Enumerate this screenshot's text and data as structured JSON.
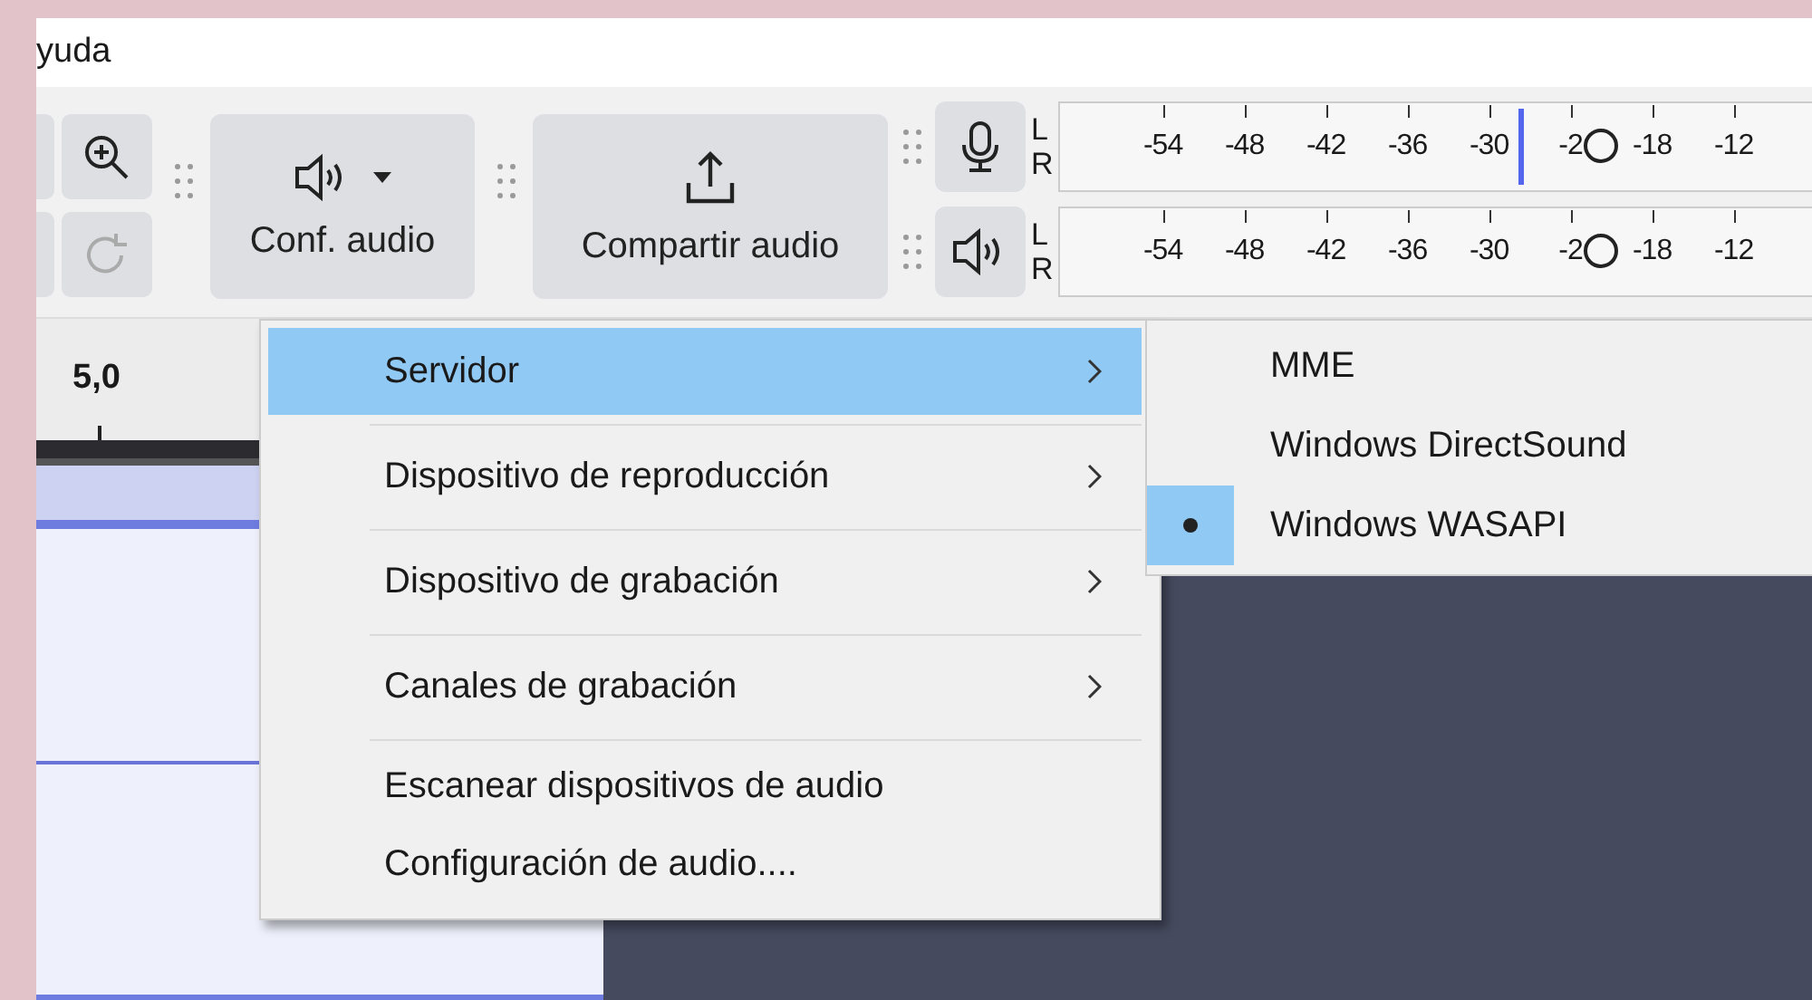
{
  "menu_bar": {
    "items": [
      "yuda"
    ]
  },
  "toolbar": {
    "buttons": [
      {
        "kind": "stub"
      },
      {
        "kind": "zoom"
      },
      {
        "kind": "stub"
      },
      {
        "kind": "redo",
        "disabled": true
      }
    ],
    "audio_setup": {
      "label": "Conf. audio"
    },
    "share_audio": {
      "label": "Compartir audio"
    }
  },
  "meters": [
    {
      "kind": "record",
      "channels": [
        "L",
        "R"
      ],
      "ticks": [
        "-54",
        "-48",
        "-42",
        "-36",
        "-30",
        "-2",
        "-18",
        "-12"
      ],
      "level": 0.72,
      "marker": true
    },
    {
      "kind": "playback",
      "channels": [
        "L",
        "R"
      ],
      "ticks": [
        "-54",
        "-48",
        "-42",
        "-36",
        "-30",
        "-2",
        "-18",
        "-12"
      ],
      "level": 0.72,
      "marker": false
    }
  ],
  "ruler": {
    "label": "5,0"
  },
  "menu": {
    "items": [
      {
        "label": "Servidor",
        "submenu": true,
        "selected": true
      },
      {
        "label": "Dispositivo de reproducción",
        "submenu": true,
        "selected": false
      },
      {
        "label": "Dispositivo de grabación",
        "submenu": true,
        "selected": false
      },
      {
        "label": "Canales de grabación",
        "submenu": true,
        "selected": false
      },
      {
        "label": "Escanear dispositivos de audio",
        "submenu": false,
        "selected": false
      },
      {
        "label": "Configuración de audio....",
        "submenu": false,
        "selected": false
      }
    ]
  },
  "submenu": {
    "items": [
      {
        "label": "MME",
        "checked": false
      },
      {
        "label": "Windows DirectSound",
        "checked": false
      },
      {
        "label": "Windows WASAPI",
        "checked": true
      }
    ]
  }
}
